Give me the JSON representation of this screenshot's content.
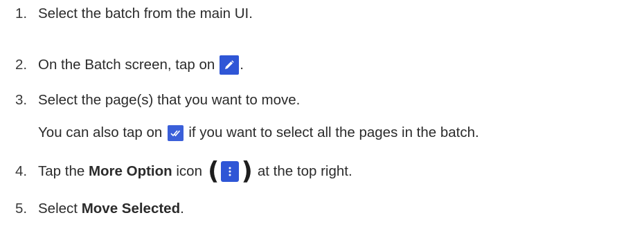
{
  "steps": [
    {
      "number": "1.",
      "text": "Select the batch from the main UI."
    },
    {
      "number": "2.",
      "text_before": "On the Batch screen, tap on",
      "icon": "edit-pencil-icon",
      "text_after": "."
    },
    {
      "number": "3.",
      "text": "Select the page(s) that you want to move.",
      "note_before": "You can also tap on",
      "note_icon": "select-all-check-icon",
      "note_after": "if you want to select all the pages in the batch."
    },
    {
      "number": "4.",
      "text_before": "Tap the",
      "bold": "More Option",
      "text_mid": "icon",
      "paren_open": "(",
      "icon": "more-options-vertical-dots-icon",
      "paren_close": ")",
      "text_after": "at the top right."
    },
    {
      "number": "5.",
      "text_before": "Select",
      "bold": "Move Selected",
      "text_after": "."
    }
  ],
  "colors": {
    "icon_background": "#2f56d6",
    "text": "#2b2b2b"
  }
}
